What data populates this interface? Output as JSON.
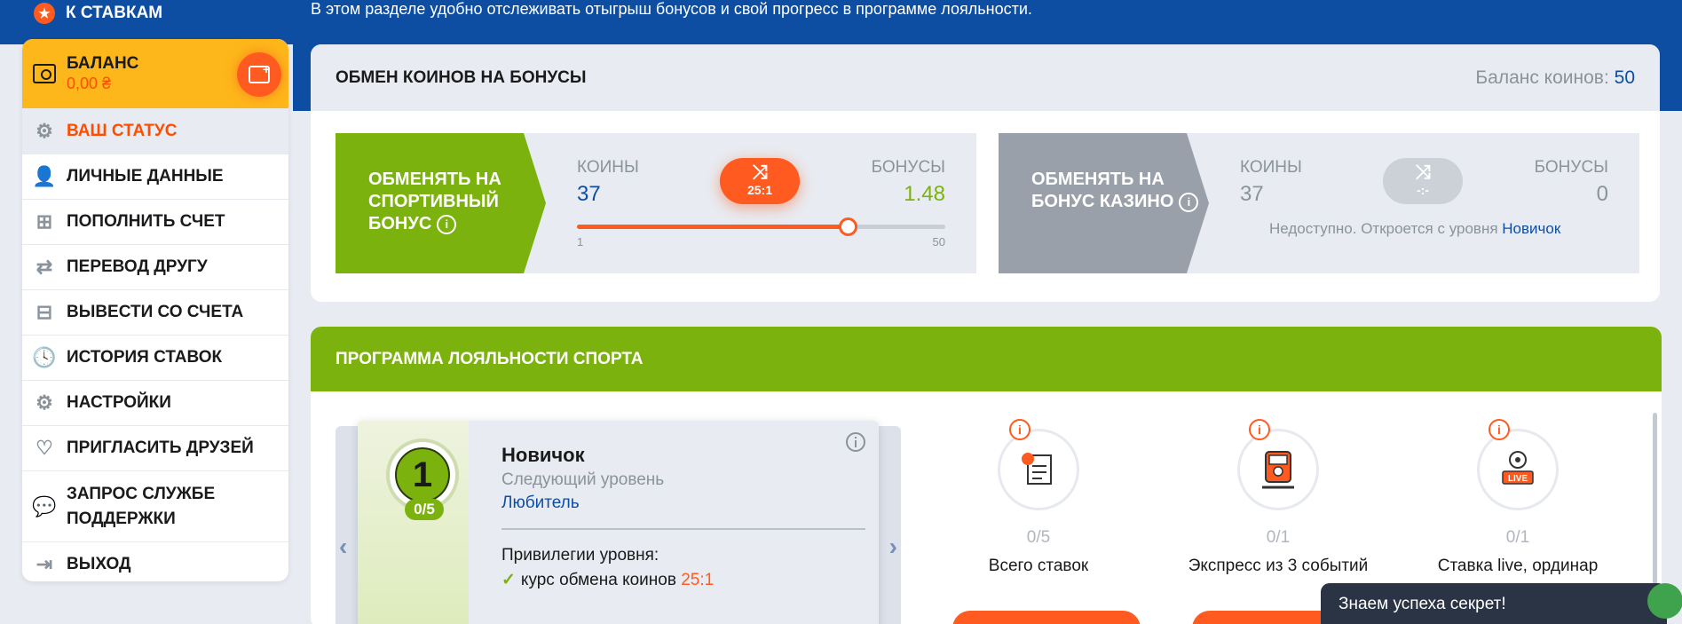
{
  "header": {
    "back_label": "К СТАВКАМ",
    "intro": "В этом разделе удобно отслеживать отыгрыш бонусов и свой прогресс в программе лояльности."
  },
  "sidebar": {
    "balance_label": "БАЛАНС",
    "balance_value": "0,00 ₴",
    "items": [
      {
        "label": "ВАШ СТАТУС",
        "icon": "gear-icon",
        "active": true
      },
      {
        "label": "ЛИЧНЫЕ ДАННЫЕ",
        "icon": "user-icon"
      },
      {
        "label": "ПОПОЛНИТЬ СЧЕТ",
        "icon": "deposit-icon"
      },
      {
        "label": "ПЕРЕВОД ДРУГУ",
        "icon": "transfer-icon"
      },
      {
        "label": "ВЫВЕСТИ СО СЧЕТА",
        "icon": "withdraw-icon"
      },
      {
        "label": "ИСТОРИЯ СТАВОК",
        "icon": "clock-icon"
      },
      {
        "label": "НАСТРОЙКИ",
        "icon": "settings-icon"
      },
      {
        "label": "ПРИГЛАСИТЬ ДРУЗЕЙ",
        "icon": "handshake-icon"
      },
      {
        "label": "ЗАПРОС СЛУЖБЕ ПОДДЕРЖКИ",
        "icon": "chat-icon"
      },
      {
        "label": "ВЫХОД",
        "icon": "logout-icon"
      }
    ]
  },
  "exchange": {
    "title": "ОБМЕН КОИНОВ НА БОНУСЫ",
    "coin_balance_label": "Баланс коинов:",
    "coin_balance_value": "50",
    "sport": {
      "title": "ОБМЕНЯТЬ НА СПОРТИВНЫЙ БОНУС",
      "coins_label": "КОИНЫ",
      "coins_value": "37",
      "bonus_label": "БОНУСЫ",
      "bonus_value": "1.48",
      "rate": "25:1",
      "slider_min": "1",
      "slider_max": "50",
      "slider_value": 37
    },
    "casino": {
      "title": "ОБМЕНЯТЬ НА БОНУС КАЗИНО",
      "coins_label": "КОИНЫ",
      "coins_value": "37",
      "bonus_label": "БОНУСЫ",
      "bonus_value": "0",
      "rate": "-:-",
      "unavailable": "Недоступно. Откроется с уровня",
      "unlock_level": "Новичок"
    }
  },
  "loyalty": {
    "title": "ПРОГРАММА ЛОЯЛЬНОСТИ СПОРТА",
    "level": {
      "number": "1",
      "progress": "0/5",
      "name": "Новичок",
      "next_label": "Следующий уровень",
      "next_name": "Любитель",
      "privileges_title": "Привилегии уровня:",
      "privilege_text": "курс обмена коинов",
      "privilege_rate": "25:1"
    },
    "tasks": [
      {
        "progress": "0/5",
        "label": "Всего ставок",
        "icon": "receipt-icon"
      },
      {
        "progress": "0/1",
        "label": "Экспресс из 3 событий",
        "icon": "train-icon"
      },
      {
        "progress": "0/1",
        "label": "Ставка live, ординар",
        "icon": "live-ball-icon"
      }
    ]
  },
  "toast": {
    "text": "Знаем успеха секрет!"
  },
  "colors": {
    "brand_blue": "#0d4ea3",
    "accent_orange": "#ff5a1f",
    "green": "#7cb20e",
    "yellow": "#fdb71a"
  }
}
